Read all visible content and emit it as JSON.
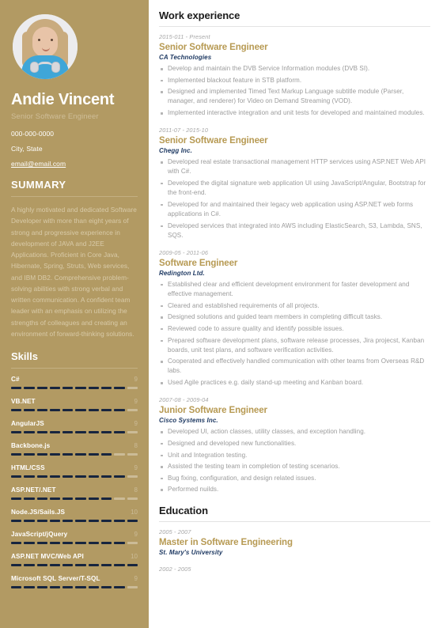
{
  "sidebar": {
    "avatar_alt": "profile-photo",
    "name": "Andie Vincent",
    "role": "Senior Software Engineer",
    "contact": {
      "phone": "000-000-0000",
      "location": "City, State",
      "email": "email@email.com"
    },
    "summary": {
      "heading": "SUMMARY",
      "text": "A highly motivated and dedicated Software Developer with more than eight years of strong and progressive experience in development of JAVA and J2EE Applications. Proficient in Core Java, Hibernate, Spring, Struts, Web services, and IBM DB2. Comprehensive problem-solving abilities with strong verbal and written communication. A confident team leader with an emphasis on utilizing the strengths of colleagues and creating an environment of forward-thinking solutions."
    },
    "skills": {
      "heading": "Skills",
      "max": 10,
      "items": [
        {
          "name": "C#",
          "value": 9
        },
        {
          "name": "VB.NET",
          "value": 9
        },
        {
          "name": "AngularJS",
          "value": 9
        },
        {
          "name": "Backbone.js",
          "value": 8
        },
        {
          "name": "HTML/CSS",
          "value": 9
        },
        {
          "name": "ASP.NET/.NET",
          "value": 8
        },
        {
          "name": "Node.JS/Sails.JS",
          "value": 10
        },
        {
          "name": "JavaScript/jQuery",
          "value": 9
        },
        {
          "name": "ASP.NET MVC/Web API",
          "value": 10
        },
        {
          "name": "Microsoft SQL Server/T-SQL",
          "value": 9
        }
      ]
    }
  },
  "main": {
    "work": {
      "heading": "Work experience",
      "entries": [
        {
          "date": "2015-011 - Present",
          "title": "Senior Software Engineer",
          "org": "CA Technologies",
          "bullets": [
            "Develop and maintain the DVB Service Information modules (DVB SI).",
            "Implemented blackout feature in STB platform.",
            "Designed and implemented Timed Text Markup Language subtitle module (Parser, manager, and renderer) for Video on Demand Streaming (VOD).",
            "Implemented interactive integration and unit tests for developed and maintained modules."
          ]
        },
        {
          "date": "2011-07 - 2015-10",
          "title": "Senior Software Engineer",
          "org": "Chegg Inc.",
          "bullets": [
            "Developed real estate transactional management HTTP services using ASP.NET Web API with C#.",
            "Developed the digital signature web application UI using JavaScript/Angular, Bootstrap for the front-end.",
            "Developed for and maintained their legacy web application using ASP.NET web forms applications in C#.",
            "Developed services that integrated into AWS including ElasticSearch, S3, Lambda, SNS, SQS."
          ]
        },
        {
          "date": "2009-05 - 2011-06",
          "title": "Software Engineer",
          "org": "Redington Ltd.",
          "bullets": [
            "Established clear and efficient development environment for faster development and effective management.",
            "Cleared and established requirements of all projects.",
            "Designed solutions and guided team members in completing difficult tasks.",
            "Reviewed code to assure quality and identify possible issues.",
            "Prepared software development plans, software release processes, Jira projecst, Kanban boards, unit test plans, and software verification activities.",
            "Cooperated and effectively handled communication with other teams from Overseas R&D labs.",
            "Used Agile practices e.g. daily stand-up meeting and Kanban board."
          ]
        },
        {
          "date": "2007-08 - 2009-04",
          "title": "Junior Software Engineer",
          "org": "Cisco Systems Inc.",
          "bullets": [
            "Developed UI, action classes, utility classes, and exception handling.",
            "Designed and developed new functionalities.",
            "Unit and Integration testing.",
            "Assisted the testing team in completion of testing scenarios.",
            "Bug fixing, configuration, and design related issues.",
            "Performed nuilds."
          ]
        }
      ]
    },
    "education": {
      "heading": "Education",
      "entries": [
        {
          "date": "2005 - 2007",
          "title": "Master in Software Engineering",
          "org": "St. Mary's University"
        },
        {
          "date": "2002 - 2005",
          "title": "",
          "org": ""
        }
      ]
    }
  },
  "colors": {
    "sidebar_bg": "#b29a63",
    "accent_gold": "#b79a53",
    "org_navy": "#1f3a63",
    "skill_filled": "#17253f",
    "skill_empty": "#cbbb97"
  }
}
